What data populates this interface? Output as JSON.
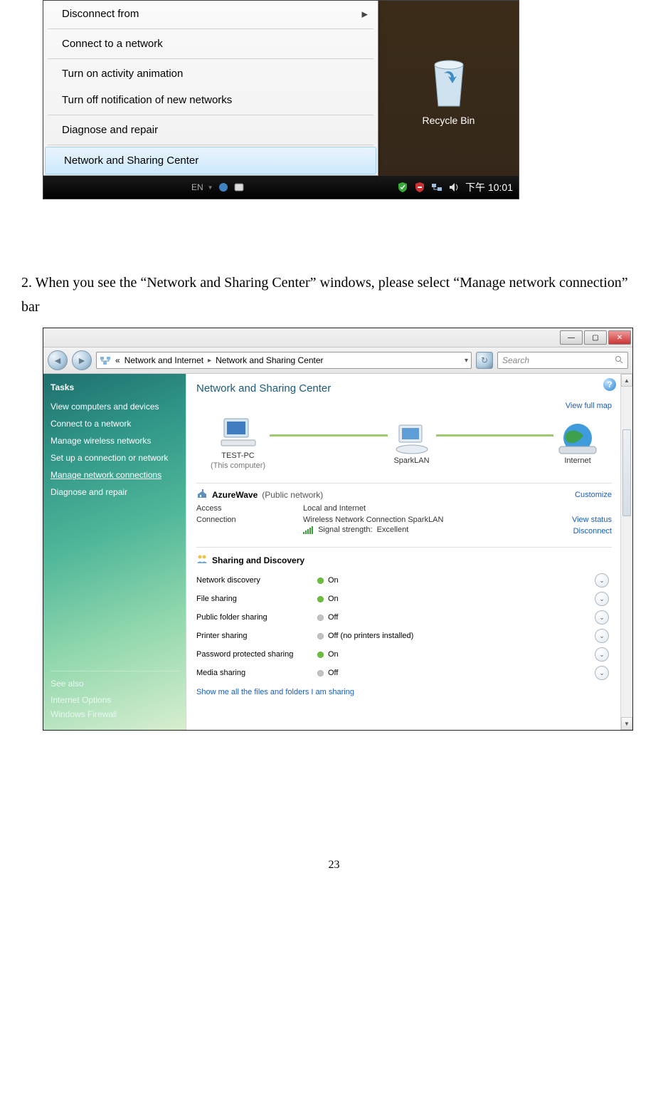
{
  "fig1": {
    "menu": {
      "disconnect_from": "Disconnect from",
      "connect": "Connect to a network",
      "activity_anim": "Turn on activity animation",
      "notif_off": "Turn off notification of new networks",
      "diagnose": "Diagnose and repair",
      "nsc": "Network and Sharing Center"
    },
    "recycle_bin_label": "Recycle Bin",
    "taskbar": {
      "lang": "EN",
      "clock": "下午 10:01"
    }
  },
  "instruction_text": "2. When you see the “Network and Sharing Center” windows, please select “Manage network connection” bar",
  "fig2": {
    "breadcrumb": {
      "back_chevrons": "«",
      "crumb1": "Network and Internet",
      "crumb2": "Network and Sharing Center"
    },
    "search_placeholder": "Search",
    "sidebar": {
      "tasks_header": "Tasks",
      "view_computers": "View computers and devices",
      "connect": "Connect to a network",
      "manage_wireless": "Manage wireless networks",
      "setup_conn": "Set up a connection or network",
      "manage_conn": "Manage network connections",
      "diagnose": "Diagnose and repair",
      "see_also_header": "See also",
      "internet_options": "Internet Options",
      "windows_firewall": "Windows Firewall"
    },
    "main": {
      "heading": "Network and Sharing Center",
      "view_full_map": "View full map",
      "nodes": {
        "pc_name": "TEST-PC",
        "pc_sub": "(This computer)",
        "router_name": "SparkLAN",
        "internet_name": "Internet"
      },
      "network": {
        "name": "AzureWave",
        "type": "(Public network)",
        "customize": "Customize",
        "access_label": "Access",
        "access_value": "Local and Internet",
        "connection_label": "Connection",
        "connection_value": "Wireless Network Connection SparkLAN",
        "signal_label": "Signal strength:",
        "signal_value": "Excellent",
        "view_status": "View status",
        "disconnect": "Disconnect"
      },
      "discovery_header": "Sharing and Discovery",
      "discovery": [
        {
          "label": "Network discovery",
          "state": "On",
          "dot": "on"
        },
        {
          "label": "File sharing",
          "state": "On",
          "dot": "on"
        },
        {
          "label": "Public folder sharing",
          "state": "Off",
          "dot": "off"
        },
        {
          "label": "Printer sharing",
          "state": "Off (no printers installed)",
          "dot": "off"
        },
        {
          "label": "Password protected sharing",
          "state": "On",
          "dot": "on"
        },
        {
          "label": "Media sharing",
          "state": "Off",
          "dot": "off"
        }
      ],
      "show_files": "Show me all the files and folders I am sharing"
    }
  },
  "page_number": "23"
}
